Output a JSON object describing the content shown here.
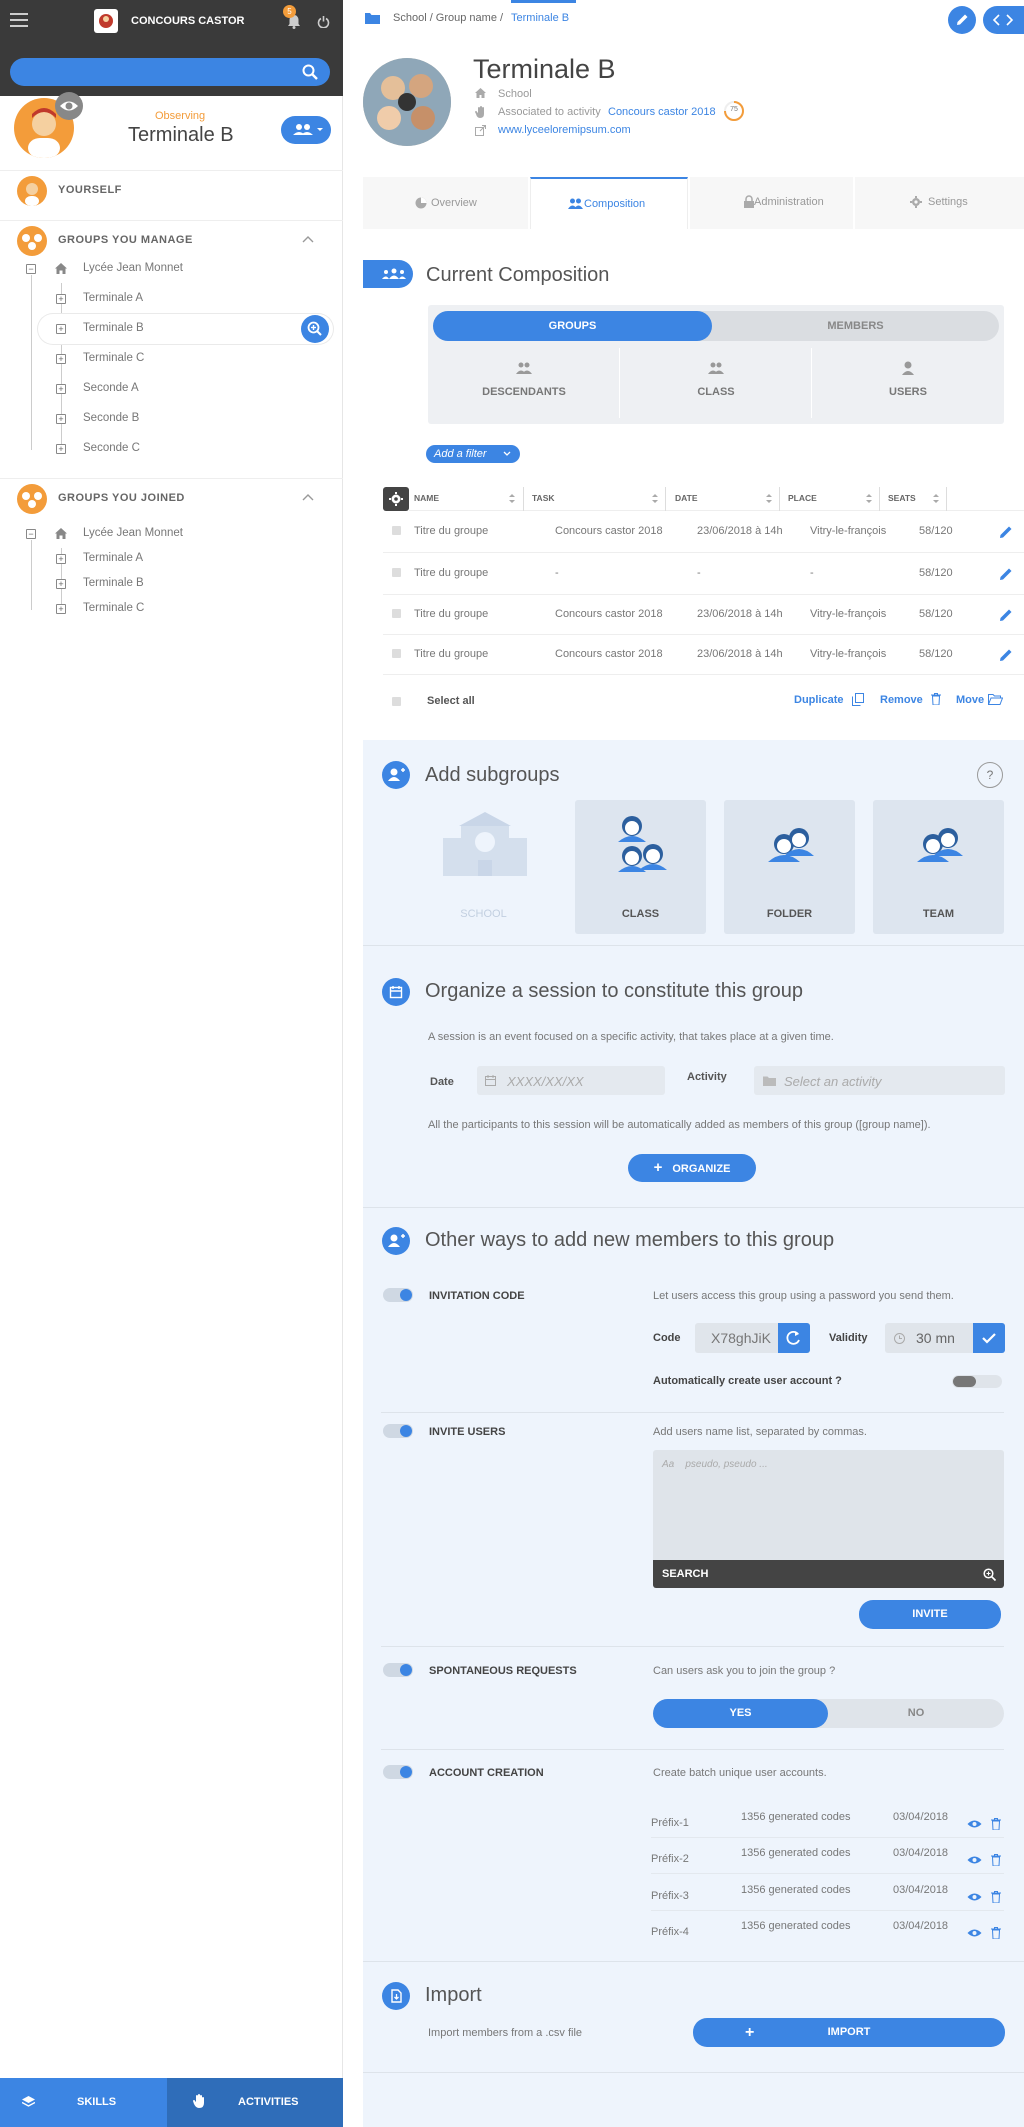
{
  "app": {
    "title": "CONCOURS CASTOR",
    "notif_count": "5"
  },
  "sidebar": {
    "search_placeholder": "",
    "observing_label": "Observing",
    "current_group": "Terminale B",
    "yourself": "YOURSELF",
    "manage_title": "GROUPS YOU MANAGE",
    "manage_items": [
      "Lycée Jean Monnet",
      "Terminale A",
      "Terminale B",
      "Terminale C",
      "Seconde A",
      "Seconde B",
      "Seconde C"
    ],
    "joined_title": "GROUPS YOU JOINED",
    "joined_items": [
      "Lycée Jean Monnet",
      "Terminale A",
      "Terminale B",
      "Terminale C"
    ],
    "bottom": {
      "skills": "SKILLS",
      "activities": "ACTIVITIES"
    }
  },
  "breadcrumb": {
    "path": "School / Group name /",
    "current": "Terminale B"
  },
  "group": {
    "name": "Terminale B",
    "type": "School",
    "assoc_prefix": "Associated to activity",
    "assoc_link": "Concours castor 2018",
    "assoc_score": "75",
    "url": "www.lyceeloremipsum.com"
  },
  "tabs": [
    "Overview",
    "Composition",
    "Administration",
    "Settings"
  ],
  "composition": {
    "title": "Current Composition",
    "toggle": [
      "GROUPS",
      "MEMBERS"
    ],
    "filters": [
      "DESCENDANTS",
      "CLASS",
      "USERS"
    ],
    "add_filter": "Add a filter",
    "columns": [
      "NAME",
      "TASK",
      "DATE",
      "PLACE",
      "SEATS"
    ],
    "rows": [
      [
        "Titre du groupe",
        "Concours castor 2018",
        "23/06/2018 à 14h",
        "Vitry-le-françois",
        "58/120"
      ],
      [
        "Titre du groupe",
        "-",
        "-",
        "-",
        "58/120"
      ],
      [
        "Titre du groupe",
        "Concours castor 2018",
        "23/06/2018 à 14h",
        "Vitry-le-françois",
        "58/120"
      ],
      [
        "Titre du groupe",
        "Concours castor 2018",
        "23/06/2018 à 14h",
        "Vitry-le-françois",
        "58/120"
      ]
    ],
    "select_all": "Select all",
    "actions": [
      "Duplicate",
      "Remove",
      "Move"
    ]
  },
  "subgroups": {
    "title": "Add subgroups",
    "help": "?",
    "tiles": [
      "SCHOOL",
      "CLASS",
      "FOLDER",
      "TEAM"
    ]
  },
  "session": {
    "title": "Organize a session to constitute this group",
    "desc": "A session is an event focused on a specific activity, that takes place at a given time.",
    "date_label": "Date",
    "date_placeholder": "XXXX/XX/XX",
    "activity_label": "Activity",
    "activity_placeholder": "Select an activity",
    "note": "All the participants to this session will be automatically added as members of this group ([group name]).",
    "button": "ORGANIZE"
  },
  "other": {
    "title": "Other ways to add new members to this group",
    "invitation": {
      "label": "INVITATION CODE",
      "desc": "Let users access this group using a password you send them.",
      "code_label": "Code",
      "code": "X78ghJiK",
      "validity_label": "Validity",
      "validity": "30 mn",
      "auto_label": "Automatically create user account ?"
    },
    "invite": {
      "label": "INVITE USERS",
      "desc": "Add users name list, separated by commas.",
      "placeholder": "Aa    pseudo, pseudo ...",
      "search": "SEARCH",
      "button": "INVITE"
    },
    "spontaneous": {
      "label": "SPONTANEOUS REQUESTS",
      "desc": "Can users ask you to join the group ?",
      "yes": "YES",
      "no": "NO"
    },
    "account": {
      "label": "ACCOUNT CREATION",
      "desc": "Create batch unique user accounts.",
      "rows": [
        [
          "Préfix-1",
          "1356 generated codes",
          "03/04/2018"
        ],
        [
          "Préfix-2",
          "1356 generated codes",
          "03/04/2018"
        ],
        [
          "Préfix-3",
          "1356 generated codes",
          "03/04/2018"
        ],
        [
          "Préfix-4",
          "1356 generated codes",
          "03/04/2018"
        ]
      ]
    }
  },
  "import": {
    "title": "Import",
    "desc": "Import members from a .csv file",
    "button": "IMPORT"
  },
  "colors": {
    "accent": "#3c85e3",
    "orange": "#f39c3a",
    "dark": "#3a3a3a"
  }
}
